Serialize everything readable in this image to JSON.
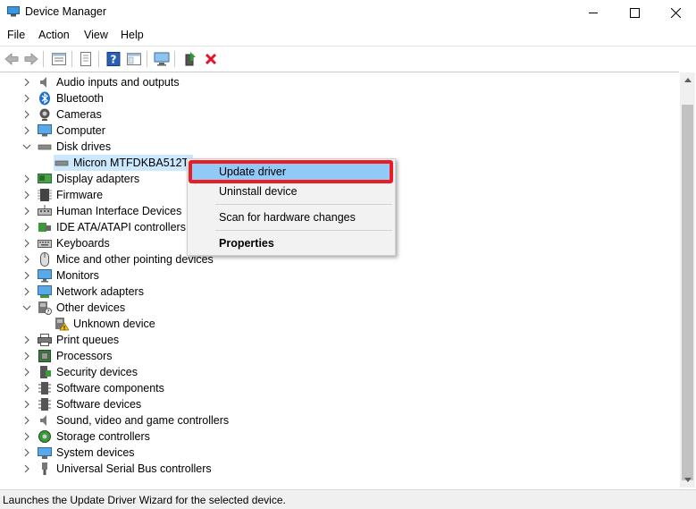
{
  "window": {
    "title": "Device Manager",
    "app_icon": "device-manager-icon",
    "controls": [
      "minimize-icon",
      "maximize-icon",
      "close-icon"
    ]
  },
  "menubar": {
    "items": [
      "File",
      "Action",
      "View",
      "Help"
    ]
  },
  "toolbar": {
    "buttons": [
      "back-icon",
      "forward-icon",
      "properties-pane-icon",
      "show-hidden-icon",
      "help-icon",
      "console-tree-icon",
      "scan-hardware-icon",
      "update-driver-icon",
      "uninstall-icon"
    ]
  },
  "tree": {
    "nodes": [
      {
        "label": "Audio inputs and outputs",
        "icon": "speaker-icon",
        "expanded": false
      },
      {
        "label": "Bluetooth",
        "icon": "bluetooth-icon",
        "expanded": false
      },
      {
        "label": "Cameras",
        "icon": "camera-icon",
        "expanded": false
      },
      {
        "label": "Computer",
        "icon": "computer-icon",
        "expanded": false
      },
      {
        "label": "Disk drives",
        "icon": "disk-drive-icon",
        "expanded": true,
        "children": [
          {
            "label": "Micron MTFDKBA512TFH",
            "icon": "disk-drive-icon",
            "selected": true
          }
        ]
      },
      {
        "label": "Display adapters",
        "icon": "display-adapter-icon",
        "expanded": false
      },
      {
        "label": "Firmware",
        "icon": "firmware-icon",
        "expanded": false
      },
      {
        "label": "Human Interface Devices",
        "icon": "hid-icon",
        "expanded": false
      },
      {
        "label": "IDE ATA/ATAPI controllers",
        "icon": "ide-controller-icon",
        "expanded": false
      },
      {
        "label": "Keyboards",
        "icon": "keyboard-icon",
        "expanded": false
      },
      {
        "label": "Mice and other pointing devices",
        "icon": "mouse-icon",
        "expanded": false
      },
      {
        "label": "Monitors",
        "icon": "monitor-icon",
        "expanded": false
      },
      {
        "label": "Network adapters",
        "icon": "network-adapter-icon",
        "expanded": false
      },
      {
        "label": "Other devices",
        "icon": "other-devices-icon",
        "expanded": true,
        "children": [
          {
            "label": "Unknown device",
            "icon": "unknown-device-warning-icon",
            "selected": false
          }
        ]
      },
      {
        "label": "Print queues",
        "icon": "printer-icon",
        "expanded": false
      },
      {
        "label": "Processors",
        "icon": "processor-icon",
        "expanded": false
      },
      {
        "label": "Security devices",
        "icon": "security-device-icon",
        "expanded": false
      },
      {
        "label": "Software components",
        "icon": "software-component-icon",
        "expanded": false
      },
      {
        "label": "Software devices",
        "icon": "software-device-icon",
        "expanded": false
      },
      {
        "label": "Sound, video and game controllers",
        "icon": "sound-icon",
        "expanded": false
      },
      {
        "label": "Storage controllers",
        "icon": "storage-controller-icon",
        "expanded": false
      },
      {
        "label": "System devices",
        "icon": "system-device-icon",
        "expanded": false
      },
      {
        "label": "Universal Serial Bus controllers",
        "icon": "usb-icon",
        "expanded": false
      }
    ]
  },
  "context_menu": {
    "items": [
      {
        "label": "Update driver",
        "highlighted": true
      },
      {
        "label": "Uninstall device"
      },
      {
        "label": "Scan for hardware changes"
      },
      {
        "label": "Properties",
        "bold": true
      }
    ],
    "annotation_color": "#ec1c24"
  },
  "status": {
    "text": "Launches the Update Driver Wizard for the selected device."
  },
  "colors": {
    "selection": "#cce8ff",
    "menu_highlight": "#91c9f7",
    "uninstall_red": "#e81123"
  }
}
